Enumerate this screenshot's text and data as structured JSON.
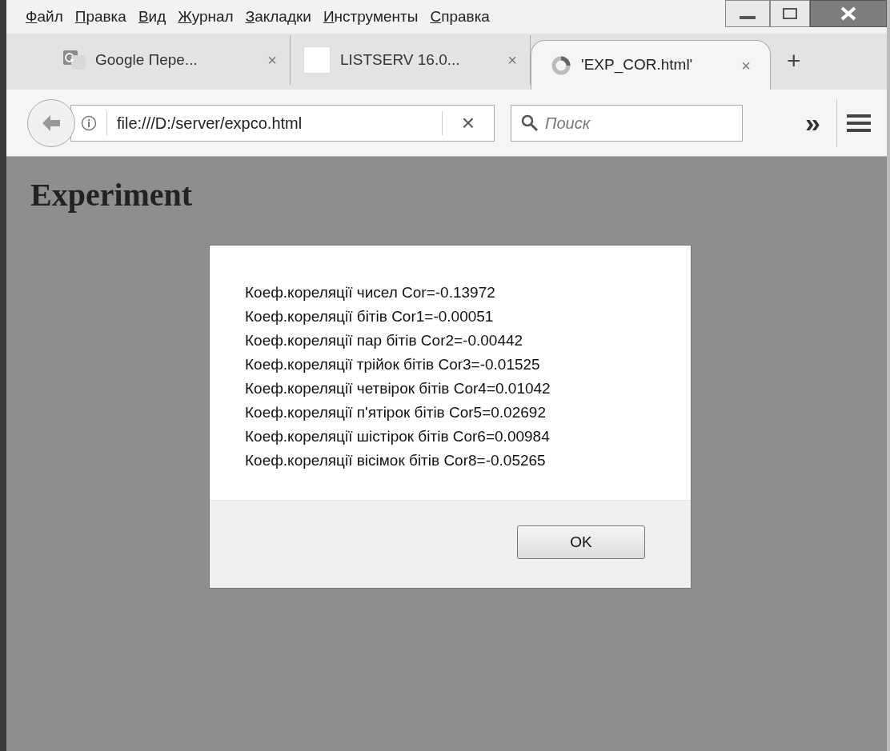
{
  "menu_bar": [
    {
      "label": "Файл"
    },
    {
      "label": "Правка"
    },
    {
      "label": "Вид"
    },
    {
      "label": "Журнал"
    },
    {
      "label": "Закладки"
    },
    {
      "label": "Инструменты"
    },
    {
      "label": "Справка"
    }
  ],
  "tabs": [
    {
      "title": "Google Пере...",
      "kind": "translate",
      "selected": false,
      "close": "×"
    },
    {
      "title": "LISTSERV 16.0...",
      "kind": "blank",
      "selected": false,
      "close": "×"
    },
    {
      "title": "'EXP_COR.html'",
      "kind": "loading",
      "selected": true,
      "close": "×"
    }
  ],
  "new_tab": "+",
  "address_bar": {
    "value": "file:///D:/server/expco.html",
    "clear": "×"
  },
  "search": {
    "placeholder": "Поиск"
  },
  "overflow": "»",
  "page": {
    "heading": "Experiment"
  },
  "dialog": {
    "lines": [
      "Коеф.кореляції чисел Cor=-0.13972",
      "Коеф.кореляції бітів Cor1=-0.00051",
      "Коеф.кореляції пар бітів Cor2=-0.00442",
      "Коеф.кореляції трійок бітів Cor3=-0.01525",
      "Коеф.кореляції четвірок бітів Cor4=0.01042",
      "Коеф.кореляції п'ятірок бітів Cor5=0.02692",
      "Коеф.кореляції шістірок бітів Cor6=0.00984",
      "Коеф.кореляції вісімок бітів Cor8=-0.05265"
    ],
    "button": "OK"
  }
}
